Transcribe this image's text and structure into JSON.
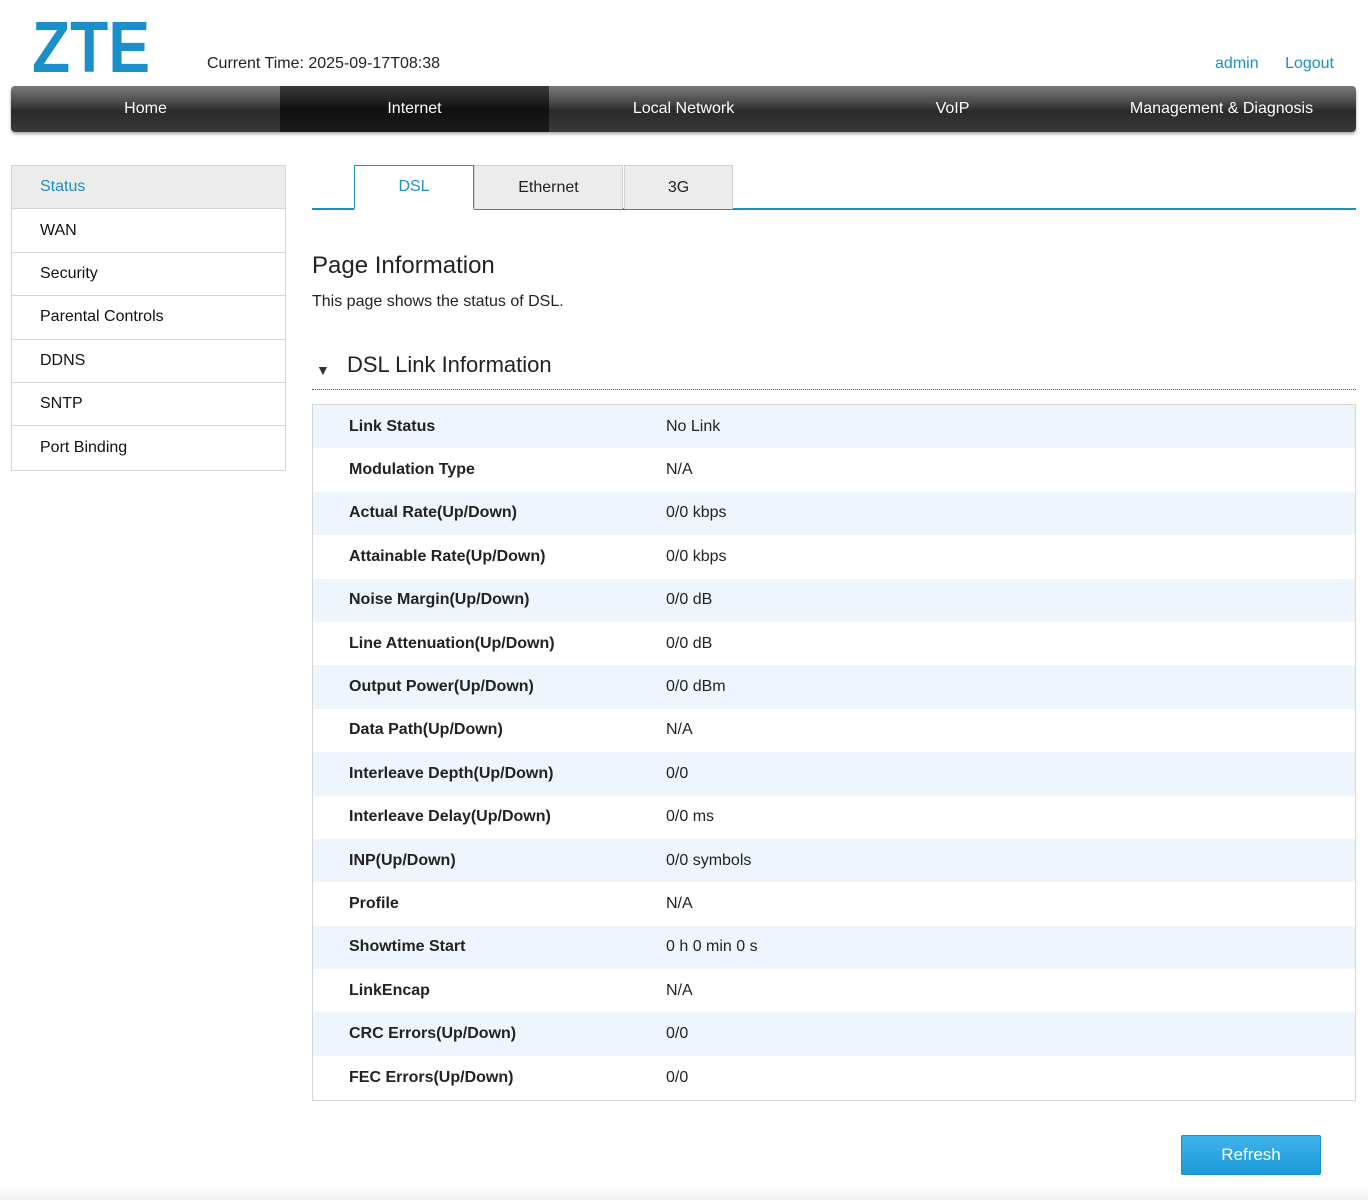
{
  "header": {
    "logo_text": "ZTE",
    "current_time": "Current Time: 2025-09-17T08:38",
    "user_links": [
      "admin",
      "Logout"
    ],
    "brand_color": "#1a8fc9"
  },
  "topnav": {
    "items": [
      "Home",
      "Internet",
      "Local Network",
      "VoIP",
      "Management & Diagnosis"
    ],
    "active": "Internet"
  },
  "sidebar": {
    "items": [
      "Status",
      "WAN",
      "Security",
      "Parental Controls",
      "DDNS",
      "SNTP",
      "Port Binding"
    ],
    "active": "Status"
  },
  "tabs": {
    "items": [
      "DSL",
      "Ethernet",
      "3G"
    ],
    "active": "DSL"
  },
  "page": {
    "title": "Page Information",
    "description": "This page shows the status of DSL."
  },
  "section": {
    "title": "DSL Link Information",
    "expanded_icon": "triangle-down-icon"
  },
  "dsl_info": [
    {
      "label": "Link Status",
      "value": "No Link"
    },
    {
      "label": "Modulation Type",
      "value": "N/A"
    },
    {
      "label": "Actual Rate(Up/Down)",
      "value": "0/0 kbps"
    },
    {
      "label": "Attainable Rate(Up/Down)",
      "value": "0/0 kbps"
    },
    {
      "label": "Noise Margin(Up/Down)",
      "value": "0/0 dB"
    },
    {
      "label": "Line Attenuation(Up/Down)",
      "value": "0/0 dB"
    },
    {
      "label": "Output Power(Up/Down)",
      "value": "0/0 dBm"
    },
    {
      "label": "Data Path(Up/Down)",
      "value": "N/A"
    },
    {
      "label": "Interleave Depth(Up/Down)",
      "value": "0/0"
    },
    {
      "label": "Interleave Delay(Up/Down)",
      "value": "0/0 ms"
    },
    {
      "label": "INP(Up/Down)",
      "value": "0/0 symbols"
    },
    {
      "label": "Profile",
      "value": "N/A"
    },
    {
      "label": "Showtime Start",
      "value": "0 h 0 min 0 s"
    },
    {
      "label": "LinkEncap",
      "value": "N/A"
    },
    {
      "label": "CRC Errors(Up/Down)",
      "value": "0/0"
    },
    {
      "label": "FEC Errors(Up/Down)",
      "value": "0/0"
    }
  ],
  "actions": {
    "refresh_label": "Refresh"
  }
}
